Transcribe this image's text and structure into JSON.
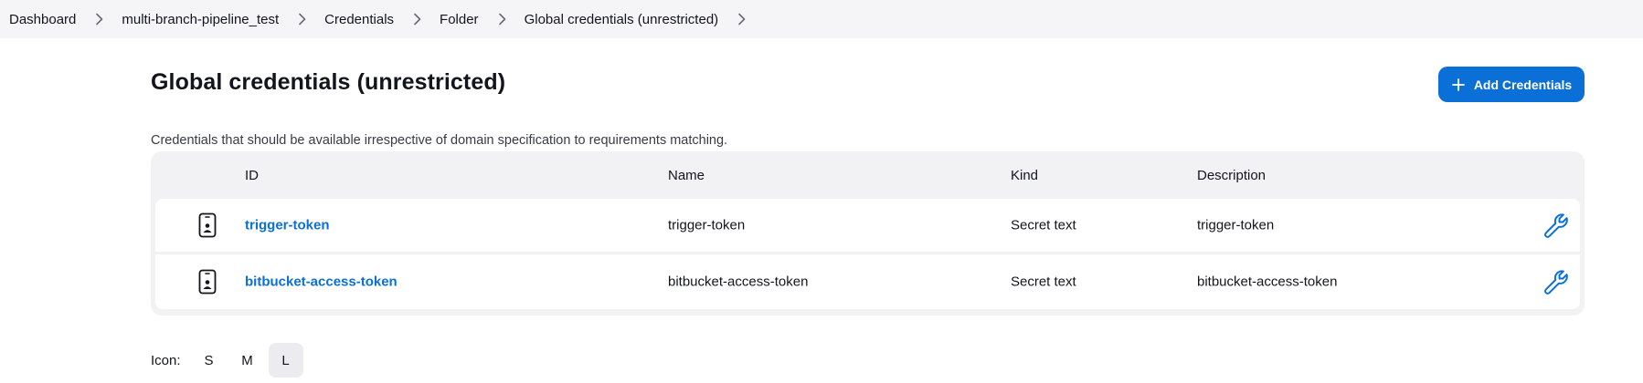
{
  "breadcrumb": [
    "Dashboard",
    "multi-branch-pipeline_test",
    "Credentials",
    "Folder",
    "Global credentials (unrestricted)"
  ],
  "page": {
    "title": "Global credentials (unrestricted)",
    "add_button_label": "Add Credentials",
    "description": "Credentials that should be available irrespective of domain specification to requirements matching."
  },
  "table": {
    "headers": {
      "id": "ID",
      "name": "Name",
      "kind": "Kind",
      "description": "Description"
    },
    "rows": [
      {
        "id": "trigger-token",
        "name": "trigger-token",
        "kind": "Secret text",
        "description": "trigger-token",
        "icon": "credential-card-icon",
        "action_icon": "wrench-icon"
      },
      {
        "id": "bitbucket-access-token",
        "name": "bitbucket-access-token",
        "kind": "Secret text",
        "description": "bitbucket-access-token",
        "icon": "credential-card-icon",
        "action_icon": "wrench-icon"
      }
    ]
  },
  "icon_size": {
    "label": "Icon:",
    "options": [
      "S",
      "M",
      "L"
    ],
    "selected": "L"
  },
  "colors": {
    "accent": "#0b6fd8",
    "breadcrumb_bg": "#f5f5f7",
    "table_bg": "#f2f2f5"
  }
}
